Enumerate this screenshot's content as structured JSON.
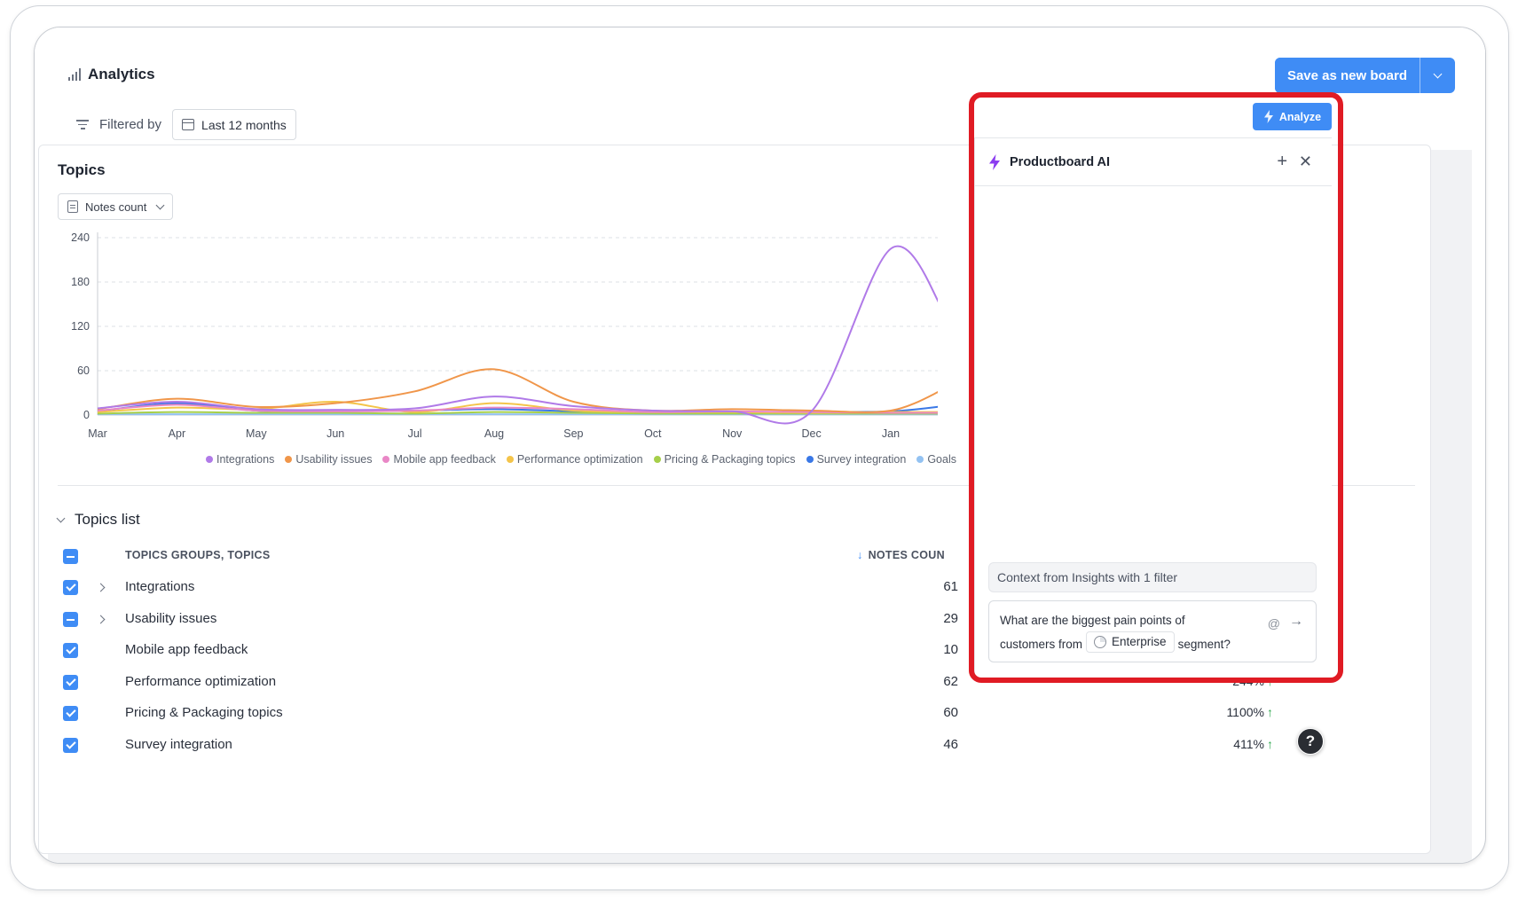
{
  "header": {
    "title": "Analytics",
    "save_label": "Save as new board"
  },
  "filter": {
    "label": "Filtered by",
    "date_range": "Last 12 months"
  },
  "topics_card": {
    "title": "Topics",
    "metric": "Notes count"
  },
  "chart_data": {
    "type": "line",
    "x": [
      "Mar",
      "Apr",
      "May",
      "Jun",
      "Jul",
      "Aug",
      "Sep",
      "Oct",
      "Nov",
      "Dec",
      "Jan"
    ],
    "ylim": [
      0,
      240
    ],
    "yticks": [
      0,
      60,
      120,
      180,
      240
    ],
    "grid": true,
    "legend_position": "bottom",
    "series": [
      {
        "name": "Integrations",
        "color": "#b07ae8",
        "values": [
          9,
          18,
          8,
          7,
          9,
          25,
          12,
          6,
          5,
          5,
          225
        ]
      },
      {
        "name": "Usability issues",
        "color": "#f0964a",
        "values": [
          8,
          22,
          11,
          16,
          32,
          62,
          18,
          6,
          8,
          6,
          6
        ]
      },
      {
        "name": "Mobile app feedback",
        "color": "#e987c6",
        "values": [
          6,
          14,
          6,
          5,
          6,
          10,
          8,
          4,
          5,
          4,
          3
        ]
      },
      {
        "name": "Performance optimization",
        "color": "#f4c44a",
        "values": [
          4,
          10,
          8,
          18,
          4,
          16,
          6,
          4,
          4,
          3,
          4
        ]
      },
      {
        "name": "Pricing & Packaging topics",
        "color": "#a6cf4a",
        "values": [
          2,
          4,
          3,
          3,
          2,
          4,
          3,
          2,
          2,
          2,
          2
        ]
      },
      {
        "name": "Survey integration",
        "color": "#3a78e6",
        "values": [
          5,
          16,
          6,
          5,
          6,
          8,
          5,
          4,
          3,
          4,
          5
        ]
      },
      {
        "name": "Goals",
        "color": "#93c2f2",
        "values": [
          1,
          1,
          1,
          1,
          1,
          1,
          1,
          1,
          1,
          1,
          1
        ]
      }
    ]
  },
  "topics_list": {
    "toggle_label": "Topics list",
    "col_name": "TOPICS GROUPS, TOPICS",
    "col_count": "NOTES COUN",
    "rows": [
      {
        "name": "Integrations",
        "count": "61",
        "change": "",
        "state": "check",
        "expandable": true
      },
      {
        "name": "Usability issues",
        "count": "29",
        "change": "",
        "state": "indet",
        "expandable": true
      },
      {
        "name": "Mobile app feedback",
        "count": "10",
        "change": "",
        "state": "check",
        "expandable": false
      },
      {
        "name": "Performance optimization",
        "count": "62",
        "change": "244%",
        "state": "check",
        "expandable": false
      },
      {
        "name": "Pricing & Packaging topics",
        "count": "60",
        "change": "1100%",
        "state": "check",
        "expandable": false
      },
      {
        "name": "Survey integration",
        "count": "46",
        "change": "411%",
        "state": "check",
        "expandable": false
      }
    ]
  },
  "ai": {
    "analyze_label": "Analyze",
    "panel_title": "Productboard AI",
    "plus_glyph": "+",
    "close_glyph": "✕",
    "context_text": "Context from Insights with 1 filter",
    "prompt_line1": "What are the biggest pain points of",
    "prompt_prefix": "customers from",
    "segment": "Enterprise",
    "prompt_suffix": "segment?",
    "at_glyph": "@",
    "send_glyph": "→"
  },
  "help": {
    "glyph": "?"
  },
  "colors": {
    "primary": "#3f8cf5",
    "highlight": "#e01b24",
    "up": "#2fa84f",
    "ai_bolt": "#8b3cf0"
  }
}
